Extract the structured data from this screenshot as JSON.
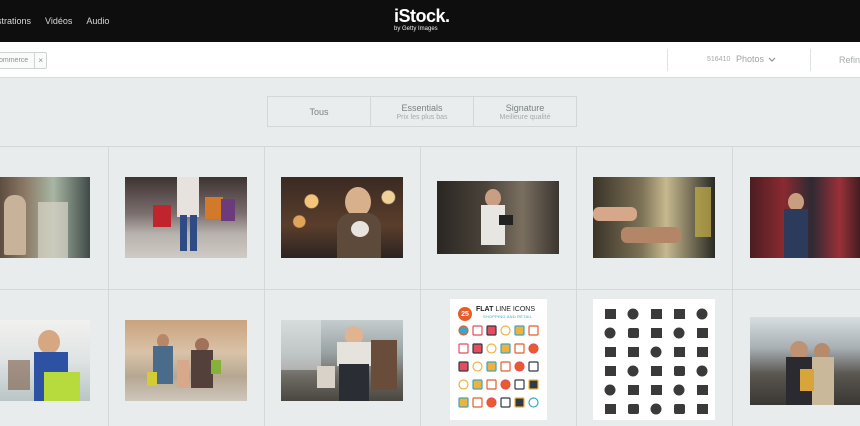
{
  "header": {
    "nav": [
      "ustrations",
      "Vidéos",
      "Audio"
    ],
    "logo_main": "iStock.",
    "logo_sub": "by Getty Images"
  },
  "filters": {
    "chip_label": "ommerce",
    "chip_close": "×",
    "result_count": "516410",
    "media_type": "Photos",
    "refine_label": "Refin"
  },
  "tabs": [
    {
      "label": "Tous",
      "sublabel": ""
    },
    {
      "label": "Essentials",
      "sublabel": "Prix les plus bas"
    },
    {
      "label": "Signature",
      "sublabel": "Meilleure qualité"
    }
  ],
  "icon_set": {
    "badge": "25",
    "title_bold": "FLAT",
    "title_rest": " LINE ICONS",
    "subtitle": "SHOPPING AND RETAIL"
  },
  "colors": {
    "header_bg": "#0e0e0e",
    "page_bg": "#e8ecec",
    "badge": "#e85c2a",
    "accent_blue": "#3aa7c6"
  }
}
